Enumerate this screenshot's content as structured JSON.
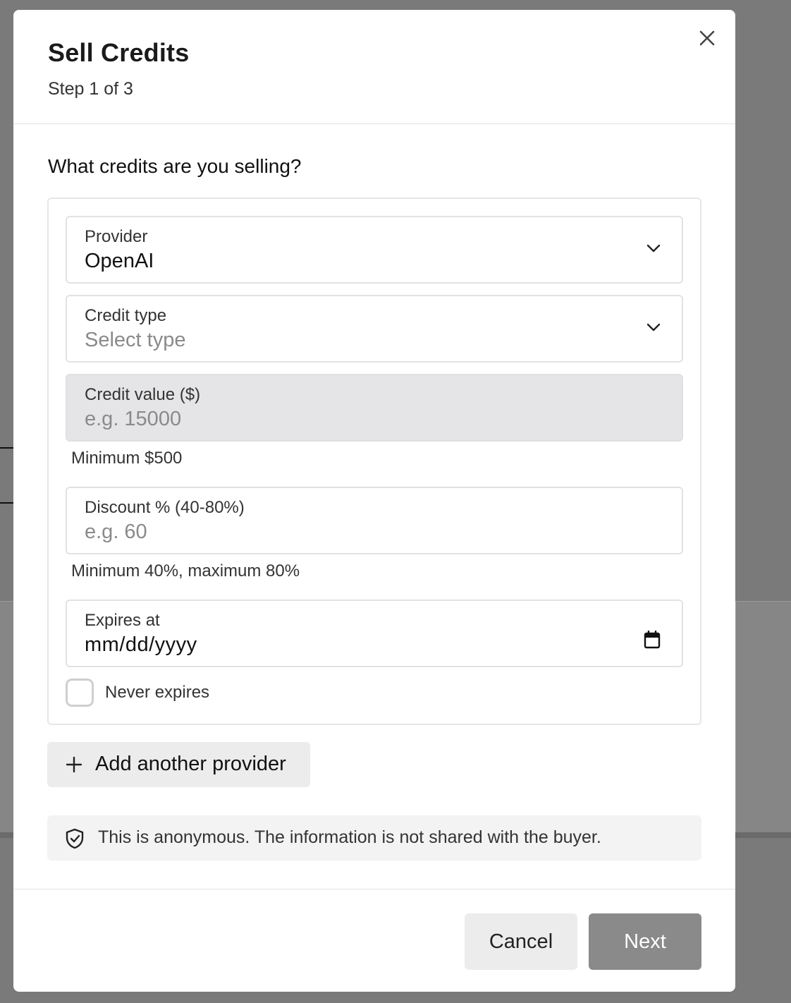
{
  "modal": {
    "title": "Sell Credits",
    "step": "Step 1 of 3",
    "close_icon": "close-icon"
  },
  "question": "What credits are you selling?",
  "fields": {
    "provider": {
      "label": "Provider",
      "value": "OpenAI",
      "icon": "chevron-down-icon"
    },
    "credit_type": {
      "label": "Credit type",
      "placeholder": "Select type",
      "icon": "chevron-down-icon"
    },
    "credit_value": {
      "label": "Credit value ($)",
      "placeholder": "e.g. 15000",
      "hint": "Minimum $500"
    },
    "discount": {
      "label": "Discount % (40-80%)",
      "placeholder": "e.g. 60",
      "hint": "Minimum 40%, maximum 80%"
    },
    "expires": {
      "label": "Expires at",
      "value": "mm/dd/yyyy",
      "icon": "calendar-icon"
    },
    "never_expires": {
      "label": "Never expires",
      "checked": false
    }
  },
  "add_provider": {
    "label": "Add another provider",
    "icon": "plus-icon"
  },
  "notice": {
    "text": "This is anonymous. The information is not shared with the buyer.",
    "icon": "shield-check-icon"
  },
  "footer": {
    "cancel_label": "Cancel",
    "next_label": "Next"
  },
  "colors": {
    "next_button": "#8a8a8a",
    "disabled_field": "#e5e5e7",
    "overlay": "#7a7a7a"
  }
}
